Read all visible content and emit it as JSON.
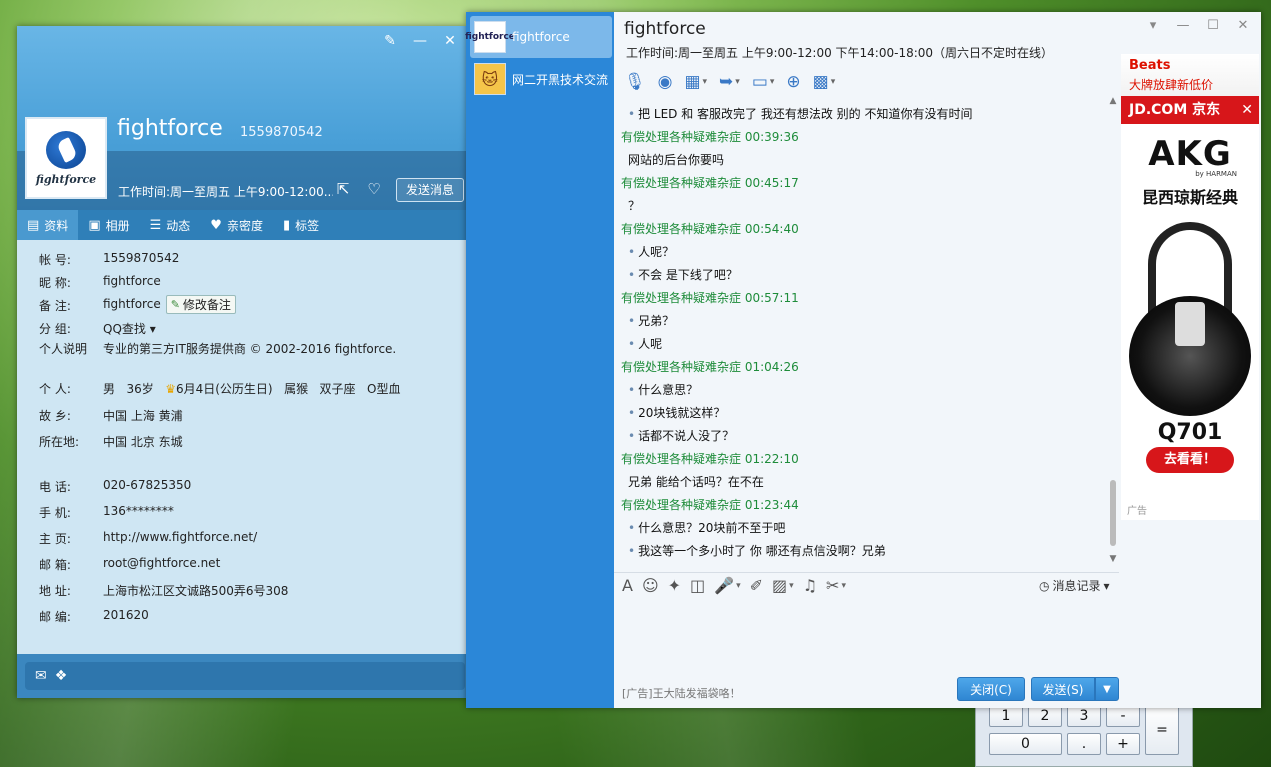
{
  "profile": {
    "nickname": "fightforce",
    "qq": "1559870542",
    "avatar_caption": "fightforce",
    "worktime_short": "工作时间:周一至周五 上午9:00-12:00...",
    "send_msg": "发送消息",
    "tabs": [
      {
        "label": "资料",
        "icon": "profile-card-icon"
      },
      {
        "label": "相册",
        "icon": "album-icon"
      },
      {
        "label": "动态",
        "icon": "feed-icon"
      },
      {
        "label": "亲密度",
        "icon": "heart-icon"
      },
      {
        "label": "标签",
        "icon": "bookmark-icon"
      }
    ],
    "fields": {
      "account_k": "帐 号:",
      "account_v": "1559870542",
      "nick_k": "昵 称:",
      "nick_v": "fightforce",
      "remark_k": "备 注:",
      "remark_v": "fightforce",
      "remark_btn": "修改备注",
      "group_k": "分 组:",
      "group_v": "QQ查找",
      "desc_k": "个人说明",
      "desc_v": "专业的第三方IT服务提供商 © 2002-2016 fightforce.",
      "person_k": "个 人:",
      "gender": "男",
      "age": "36岁",
      "birthday": "6月4日(公历生日)",
      "zodiac": "属猴",
      "star": "双子座",
      "blood": "O型血",
      "home_k": "故 乡:",
      "home_v": "中国 上海 黄浦",
      "loc_k": "所在地:",
      "loc_v": "中国 北京 东城",
      "phone_k": "电 话:",
      "phone_v": "020-67825350",
      "mobile_k": "手 机:",
      "mobile_v": "136********",
      "page_k": "主 页:",
      "page_v": "http://www.fightforce.net/",
      "mail_k": "邮 箱:",
      "mail_v": "root@fightforce.net",
      "addr_k": "地 址:",
      "addr_v": "上海市松江区文诚路500弄6号308",
      "zip_k": "邮 编:",
      "zip_v": "201620"
    }
  },
  "chat": {
    "conversations": [
      {
        "name": "fightforce",
        "avatar": "fightforce"
      },
      {
        "name": "网二开黑技术交流",
        "avatar": "cat"
      }
    ],
    "title": "fightforce",
    "subtitle": "工作时间:周一至周五 上午9:00-12:00 下午14:00-18:00（周六日不定时在线）",
    "messages": [
      {
        "type": "line",
        "text": "把 LED  和 客服改完了 我还有想法改 别的 不知道你有没有时间",
        "dot": true
      },
      {
        "type": "head",
        "text": "有偿处理各种疑难杂症  00:39:36"
      },
      {
        "type": "line",
        "text": "网站的后台你要吗",
        "dot": false
      },
      {
        "type": "head",
        "text": "有偿处理各种疑难杂症  00:45:17"
      },
      {
        "type": "line",
        "text": "？",
        "dot": false
      },
      {
        "type": "head",
        "text": "有偿处理各种疑难杂症  00:54:40"
      },
      {
        "type": "line",
        "text": "人呢？",
        "dot": true
      },
      {
        "type": "line",
        "text": "不会 是下线了吧？",
        "dot": true
      },
      {
        "type": "head",
        "text": "有偿处理各种疑难杂症  00:57:11"
      },
      {
        "type": "line",
        "text": "兄弟？",
        "dot": true
      },
      {
        "type": "line",
        "text": "人呢",
        "dot": true
      },
      {
        "type": "head",
        "text": "有偿处理各种疑难杂症  01:04:26"
      },
      {
        "type": "line",
        "text": "什么意思？",
        "dot": true
      },
      {
        "type": "line",
        "text": "20块钱就这样？",
        "dot": true
      },
      {
        "type": "line",
        "text": "话都不说人没了？",
        "dot": true
      },
      {
        "type": "head",
        "text": "有偿处理各种疑难杂症  01:22:10"
      },
      {
        "type": "line",
        "text": "兄弟  能给个话吗？在不在",
        "dot": false
      },
      {
        "type": "head",
        "text": "有偿处理各种疑难杂症  01:23:44"
      },
      {
        "type": "line",
        "text": "什么意思？20块前不至于吧",
        "dot": true
      },
      {
        "type": "line",
        "text": "我这等一个多小时了  你 哪还有点信没啊？兄弟",
        "dot": true
      }
    ],
    "history_label": "消息记录",
    "ad_text": "[广告]王大陆发福袋咯！",
    "close_btn": "关闭(C)",
    "send_btn": "发送(S)"
  },
  "ad": {
    "brand": "Beats",
    "slogan": "大牌放肆新低价",
    "jd": "JD.COM 京东",
    "akg": "AKG",
    "harman": "by HARMAN",
    "cn": "昆西琼斯经典",
    "model": "Q701",
    "go": "去看看！",
    "label": "广告"
  },
  "calc": {
    "keys_row1": [
      "1",
      "2",
      "3",
      "-"
    ],
    "keys_row2": [
      "0",
      ".",
      "+"
    ],
    "equals": "="
  }
}
